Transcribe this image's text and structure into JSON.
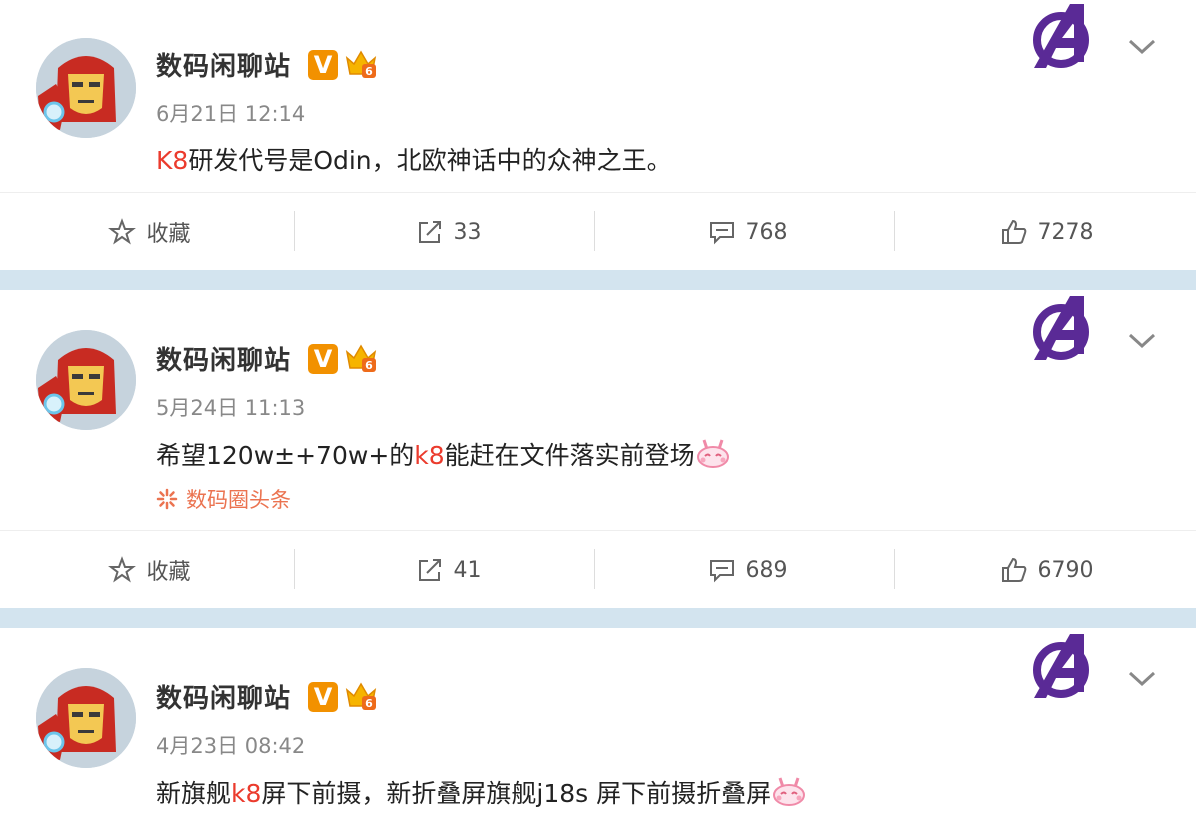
{
  "posts": [
    {
      "user": "数码闲聊站",
      "verified_badge": "V",
      "time": "6月21日 12:14",
      "content_prefix": "",
      "content_highlight": "K8",
      "content_suffix": "研发代号是Odin，北欧神话中的众神之王。",
      "has_emoji": false,
      "source": "",
      "actions": {
        "favorite": "收藏",
        "repost": "33",
        "comment": "768",
        "like": "7278"
      }
    },
    {
      "user": "数码闲聊站",
      "verified_badge": "V",
      "time": "5月24日 11:13",
      "content_prefix": "希望120w±+70w+的",
      "content_highlight": "k8",
      "content_suffix": "能赶在文件落实前登场",
      "has_emoji": true,
      "source": "数码圈头条",
      "actions": {
        "favorite": "收藏",
        "repost": "41",
        "comment": "689",
        "like": "6790"
      }
    },
    {
      "user": "数码闲聊站",
      "verified_badge": "V",
      "time": "4月23日 08:42",
      "content_prefix": "新旗舰",
      "content_highlight": "k8",
      "content_suffix": "屏下前摄，新折叠屏旗舰j18s 屏下前摄折叠屏",
      "has_emoji": true,
      "source": "",
      "actions": null
    }
  ],
  "icons": {
    "favorite": "star-outline-icon",
    "repost": "share-icon",
    "comment": "comment-icon",
    "like": "thumbs-up-icon",
    "menu": "chevron-down-icon",
    "badge": "avengers-logo-icon"
  },
  "colors": {
    "highlight": "#eb3b2d",
    "source": "#eb7350",
    "verified": "#f29100",
    "page_bg": "#d3e4ef"
  }
}
